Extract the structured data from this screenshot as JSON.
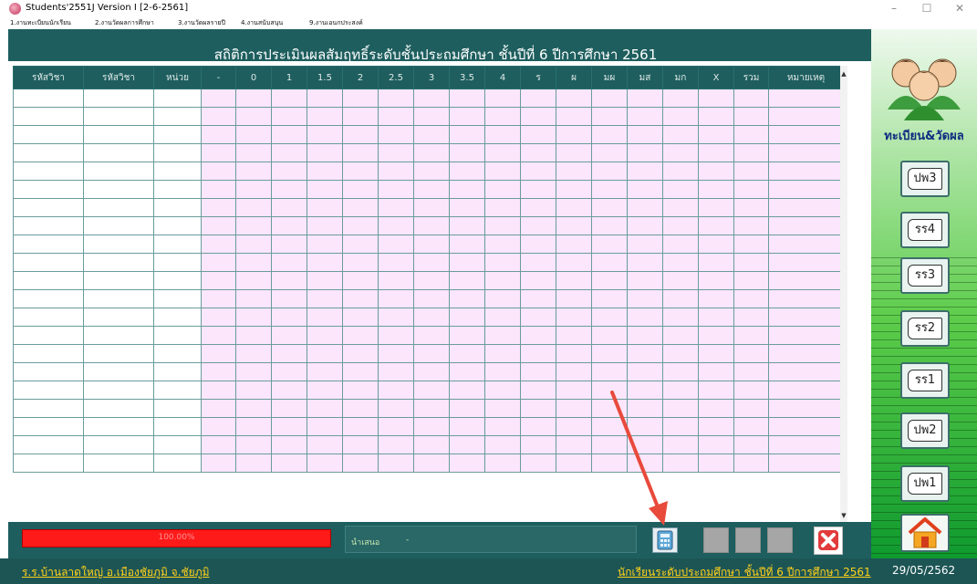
{
  "window": {
    "title": "Students'2551J Version I [2-6-2561]",
    "controls": [
      "–",
      "☐",
      "✕"
    ]
  },
  "menu": [
    "1.งานทะเบียนนักเรียน",
    "2.งานวัดผลการศึกษา",
    "3.งานวัดผลรายปี",
    "4.งานสนับสนุน",
    "9.งานเอนกประสงค์"
  ],
  "page_title": "สถิติการประเมินผลสัมฤทธิ์ระดับชั้นประถมศึกษา  ชั้นปีที่ 6  ปีการศึกษา 2561",
  "table": {
    "headers": [
      "รหัสวิชา",
      "รหัสวิชา",
      "หน่วย",
      "-",
      "0",
      "1",
      "1.5",
      "2",
      "2.5",
      "3",
      "3.5",
      "4",
      "ร",
      "ผ",
      "มผ",
      "มส",
      "มก",
      "X",
      "รวม",
      "หมายเหตุ"
    ],
    "row_count": 21,
    "white_columns": 3
  },
  "progress": {
    "label": "100.00%",
    "value": 1.0,
    "color": "#ff1a1a"
  },
  "presenter": {
    "label": "นำเสนอ",
    "value": "-"
  },
  "sidebar": {
    "heading": "ทะเบียน&วัดผล",
    "buttons": [
      "ปพ3",
      "รร4",
      "รร3",
      "รร2",
      "รร1",
      "ปพ2",
      "ปพ1"
    ]
  },
  "footer": {
    "school": "ร.ร.บ้านลาดใหญ่  อ.เมืองชัยภูมิ  จ.ชัยภูมิ",
    "level": "นักเรียนระดับประถมศึกษา  ชั้นปีที่ 6  ปีการศึกษา 2561",
    "date": "29/05/2562"
  },
  "colors": {
    "header_teal": "#1e5e5e",
    "pink_cell": "#fce6fc",
    "footer_text": "#ffd11a",
    "arrow": "#e84a3c"
  }
}
